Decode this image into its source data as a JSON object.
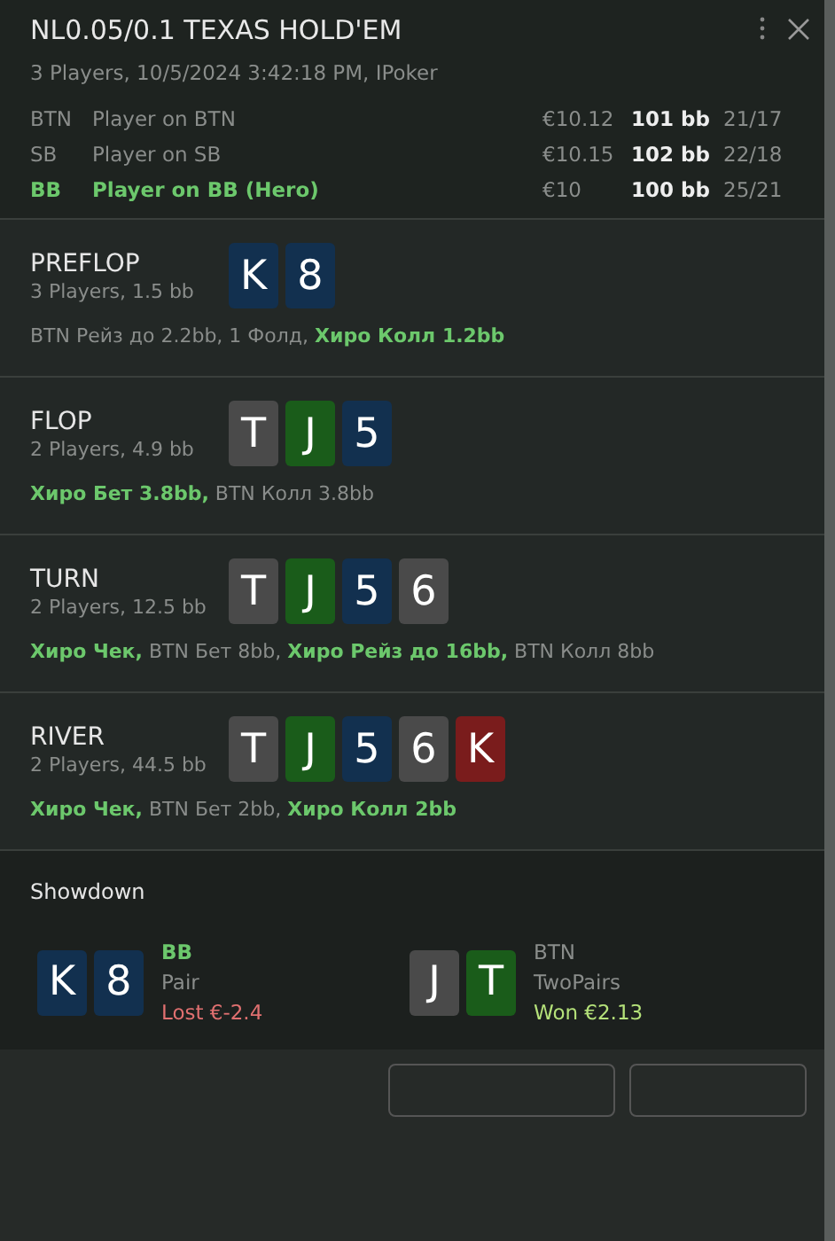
{
  "header": {
    "title": "NL0.05/0.1 TEXAS HOLD'EM",
    "subtitle": "3 Players, 10/5/2024 3:42:18 PM, IPoker"
  },
  "players": [
    {
      "position": "BTN",
      "name": "Player on BTN",
      "money": "€10.12",
      "stack": "101 bb",
      "stats": "21/17",
      "hero": false
    },
    {
      "position": "SB",
      "name": "Player on SB",
      "money": "€10.15",
      "stack": "102 bb",
      "stats": "22/18",
      "hero": false
    },
    {
      "position": "BB",
      "name": "Player on BB (Hero)",
      "money": "€10",
      "stack": "100 bb",
      "stats": "25/21",
      "hero": true
    }
  ],
  "streets": [
    {
      "name": "PREFLOP",
      "info": "3 Players, 1.5 bb",
      "cards": [
        {
          "rank": "K",
          "color": "#12304f"
        },
        {
          "rank": "8",
          "color": "#12304f"
        }
      ],
      "actions": "BTN Рейз до 2.2bb, 1 Фолд, **Хиро Колл 1.2bb**"
    },
    {
      "name": "FLOP",
      "info": "2 Players, 4.9 bb",
      "cards": [
        {
          "rank": "T",
          "color": "#4a4a4a"
        },
        {
          "rank": "J",
          "color": "#1a5c1a"
        },
        {
          "rank": "5",
          "color": "#12304f"
        }
      ],
      "actions": "**Хиро Бет 3.8bb,** BTN Колл 3.8bb"
    },
    {
      "name": "TURN",
      "info": "2 Players, 12.5 bb",
      "cards": [
        {
          "rank": "T",
          "color": "#4a4a4a"
        },
        {
          "rank": "J",
          "color": "#1a5c1a"
        },
        {
          "rank": "5",
          "color": "#12304f"
        },
        {
          "rank": "6",
          "color": "#4a4a4a"
        }
      ],
      "actions": "**Хиро Чек,** BTN Бет 8bb, **Хиро Рейз до 16bb,** BTN Колл 8bb"
    },
    {
      "name": "RIVER",
      "info": "2 Players, 44.5 bb",
      "cards": [
        {
          "rank": "T",
          "color": "#4a4a4a"
        },
        {
          "rank": "J",
          "color": "#1a5c1a"
        },
        {
          "rank": "5",
          "color": "#12304f"
        },
        {
          "rank": "6",
          "color": "#4a4a4a"
        },
        {
          "rank": "K",
          "color": "#7a1c1c"
        }
      ],
      "actions": "**Хиро Чек,** BTN Бет 2bb, **Хиро Колл 2bb**"
    }
  ],
  "showdown": {
    "title": "Showdown",
    "hands": [
      {
        "cards": [
          {
            "rank": "K",
            "color": "#12304f"
          },
          {
            "rank": "8",
            "color": "#12304f"
          }
        ],
        "position": "BB",
        "hero": true,
        "hand": "Pair",
        "result": "Lost €-2.4",
        "kind": "lost"
      },
      {
        "cards": [
          {
            "rank": "J",
            "color": "#4a4a4a"
          },
          {
            "rank": "T",
            "color": "#1a5c1a"
          }
        ],
        "position": "BTN",
        "hero": false,
        "hand": "TwoPairs",
        "result": "Won €2.13",
        "kind": "won"
      }
    ]
  }
}
